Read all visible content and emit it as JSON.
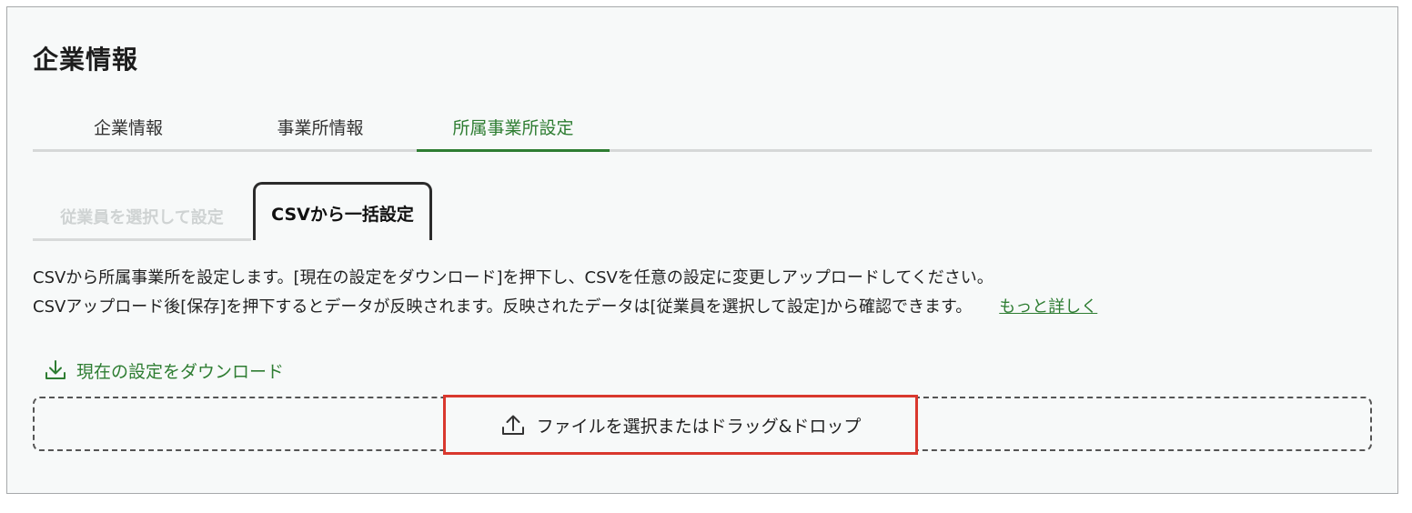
{
  "page": {
    "title": "企業情報"
  },
  "main_tabs": [
    {
      "label": "企業情報",
      "active": false
    },
    {
      "label": "事業所情報",
      "active": false
    },
    {
      "label": "所属事業所設定",
      "active": true
    }
  ],
  "sub_tabs": [
    {
      "label": "従業員を選択して設定",
      "active": false
    },
    {
      "label": "CSVから一括設定",
      "active": true
    }
  ],
  "description": {
    "line1": "CSVから所属事業所を設定します。[現在の設定をダウンロード]を押下し、CSVを任意の設定に変更しアップロードしてください。",
    "line2": "CSVアップロード後[保存]を押下するとデータが反映されます。反映されたデータは[従業員を選択して設定]から確認できます。",
    "more_link": "もっと詳しく"
  },
  "download": {
    "label": "現在の設定をダウンロード",
    "icon": "download-icon"
  },
  "upload": {
    "label": "ファイルを選択またはドラッグ&ドロップ",
    "icon": "upload-icon"
  },
  "colors": {
    "accent": "#2e7d32",
    "highlight_border": "#d9382e",
    "panel_bg": "#f7f9f9"
  }
}
